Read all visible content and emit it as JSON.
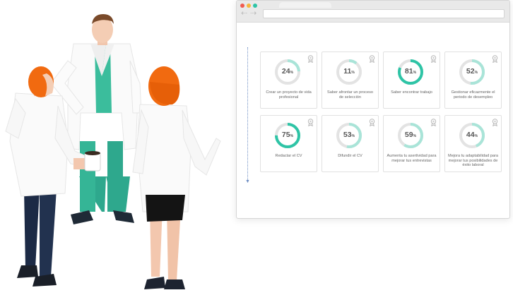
{
  "colors": {
    "accent": "#2ec4a6",
    "accent_light": "#a9e4d8",
    "track": "#e3e3e3",
    "timeline": "#6f8fc4"
  },
  "browser": {
    "controls": [
      "close-dot",
      "minimize-dot",
      "maximize-dot"
    ],
    "nav": {
      "back_glyph": "⇠",
      "forward_glyph": "⇢"
    },
    "address_value": ""
  },
  "cards": [
    {
      "value": 24,
      "value_label": "24",
      "unit": "%",
      "label": "Crear un proyecto de vida profesional",
      "style": "light",
      "icon": "award-badge-icon"
    },
    {
      "value": 11,
      "value_label": "11",
      "unit": "%",
      "label": "Saber afrontar un proceso de selección",
      "style": "light",
      "icon": "award-badge-icon"
    },
    {
      "value": 81,
      "value_label": "81",
      "unit": "%",
      "label": "Saber encontrar trabajo",
      "style": "bold",
      "icon": "award-badge-icon"
    },
    {
      "value": 52,
      "value_label": "52",
      "unit": "%",
      "label": "Gestionar eficazmente el periodo de desempleo",
      "style": "light",
      "icon": "award-badge-icon"
    },
    {
      "value": 75,
      "value_label": "75",
      "unit": "%",
      "label": "Redactar el CV",
      "style": "bold",
      "icon": "award-badge-icon"
    },
    {
      "value": 53,
      "value_label": "53",
      "unit": "%",
      "label": "Difundir el CV",
      "style": "light",
      "icon": "award-badge-icon"
    },
    {
      "value": 59,
      "value_label": "59",
      "unit": "%",
      "label": "Aumenta tu asertividad para mejorar tus entrevistas",
      "style": "light",
      "icon": "award-badge-icon"
    },
    {
      "value": 44,
      "value_label": "44",
      "unit": "%",
      "label": "Mejora tu adaptabilidad para mejorar tus posibilidades de éxito laboral",
      "style": "light",
      "icon": "award-badge-icon"
    }
  ]
}
